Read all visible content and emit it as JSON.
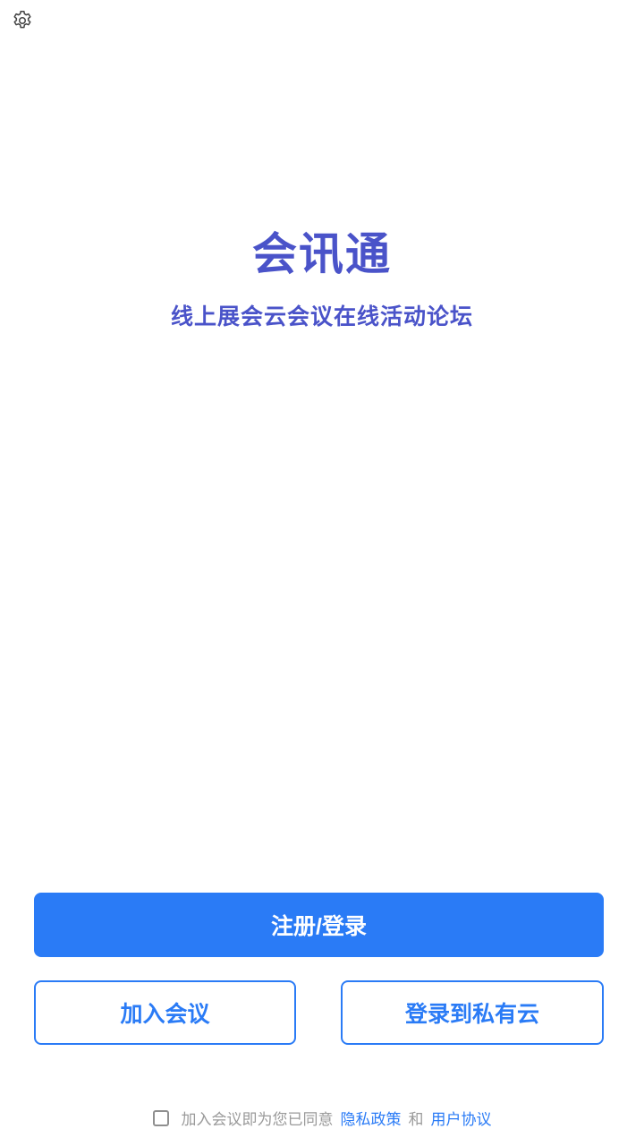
{
  "header": {
    "settings_icon": "gear-icon"
  },
  "hero": {
    "title": "会讯通",
    "subtitle": "线上展会云会议在线活动论坛"
  },
  "actions": {
    "primary_label": "注册/登录",
    "join_label": "加入会议",
    "private_cloud_label": "登录到私有云"
  },
  "agreement": {
    "checked": false,
    "prefix": "加入会议即为您已同意",
    "privacy_link": "隐私政策",
    "conjunction": "和",
    "terms_link": "用户协议"
  },
  "colors": {
    "accent": "#2a7bf6",
    "title": "#4a53c9",
    "muted": "#9a9a9a"
  }
}
